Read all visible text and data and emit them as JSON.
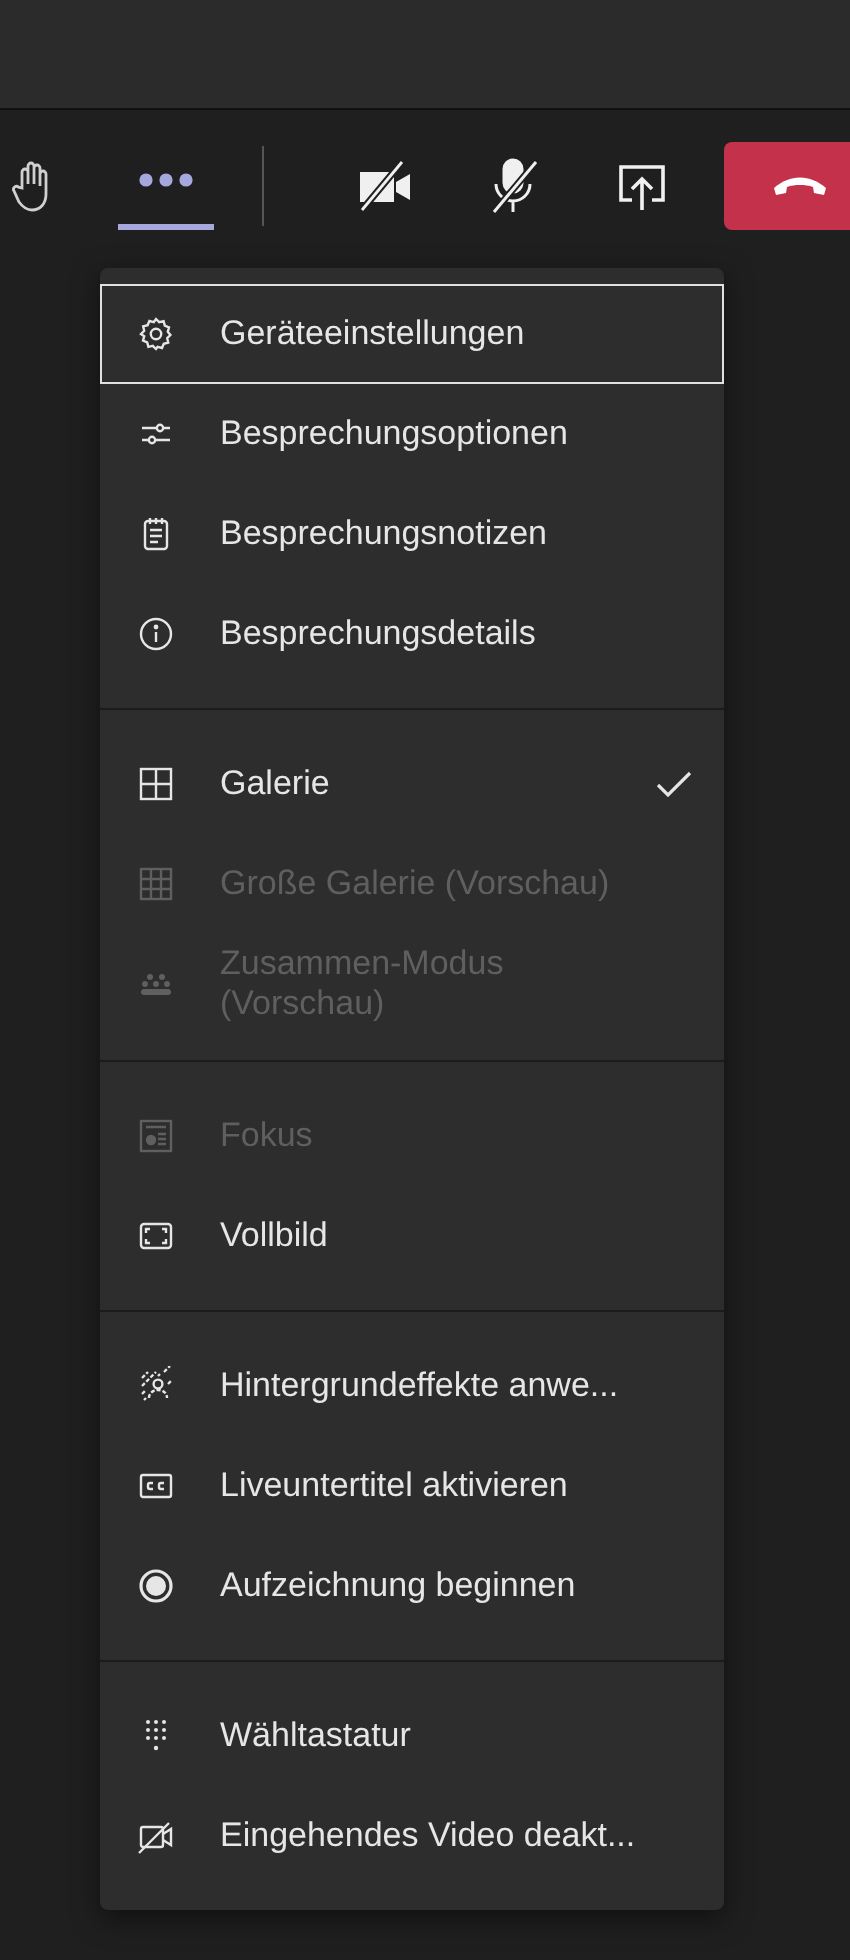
{
  "toolbar": {
    "groups": [
      {
        "divider_after": true,
        "buttons": [
          {
            "kind": "raise-hand",
            "selected": false
          },
          {
            "kind": "more",
            "selected": true
          }
        ]
      },
      {
        "divider_after": false,
        "buttons": [
          {
            "kind": "camera-off",
            "selected": false
          },
          {
            "kind": "mic-off",
            "selected": false
          },
          {
            "kind": "share",
            "selected": false
          }
        ]
      },
      {
        "buttons": [
          {
            "kind": "hang-up",
            "selected": false
          }
        ]
      }
    ]
  },
  "menu": {
    "sections": [
      {
        "items": [
          {
            "label": "Geräteeinstellungen",
            "kind": "gear",
            "focused": true,
            "disabled": false,
            "checked": false
          },
          {
            "label": "Besprechungsoptionen",
            "kind": "sliders",
            "focused": false,
            "disabled": false,
            "checked": false
          },
          {
            "label": "Besprechungsnotizen",
            "kind": "notes",
            "focused": false,
            "disabled": false,
            "checked": false
          },
          {
            "label": "Besprechungsdetails",
            "kind": "info",
            "focused": false,
            "disabled": false,
            "checked": false
          }
        ]
      },
      {
        "items": [
          {
            "label": "Galerie",
            "kind": "grid",
            "focused": false,
            "disabled": false,
            "checked": true
          },
          {
            "label": "Große Galerie (Vorschau)",
            "kind": "large-grid",
            "focused": false,
            "disabled": true,
            "checked": false
          },
          {
            "label": "Zusammen-Modus (Vorschau)",
            "kind": "people",
            "focused": false,
            "disabled": true,
            "checked": false
          }
        ]
      },
      {
        "items": [
          {
            "label": "Fokus",
            "kind": "focus",
            "focused": false,
            "disabled": true,
            "checked": false
          },
          {
            "label": "Vollbild",
            "kind": "fullscreen",
            "focused": false,
            "disabled": false,
            "checked": false
          }
        ]
      },
      {
        "items": [
          {
            "label": "Hintergrundeffekte anwe...",
            "kind": "effects",
            "focused": false,
            "disabled": false,
            "checked": false
          },
          {
            "label": "Liveuntertitel aktivieren",
            "kind": "captions",
            "focused": false,
            "disabled": false,
            "checked": false
          },
          {
            "label": "Aufzeichnung beginnen",
            "kind": "record",
            "focused": false,
            "disabled": false,
            "checked": false
          }
        ]
      },
      {
        "items": [
          {
            "label": "Wähltastatur",
            "kind": "dialpad",
            "focused": false,
            "disabled": false,
            "checked": false
          },
          {
            "label": "Eingehendes Video deakt...",
            "kind": "video-off",
            "focused": false,
            "disabled": false,
            "checked": false
          }
        ]
      }
    ]
  }
}
